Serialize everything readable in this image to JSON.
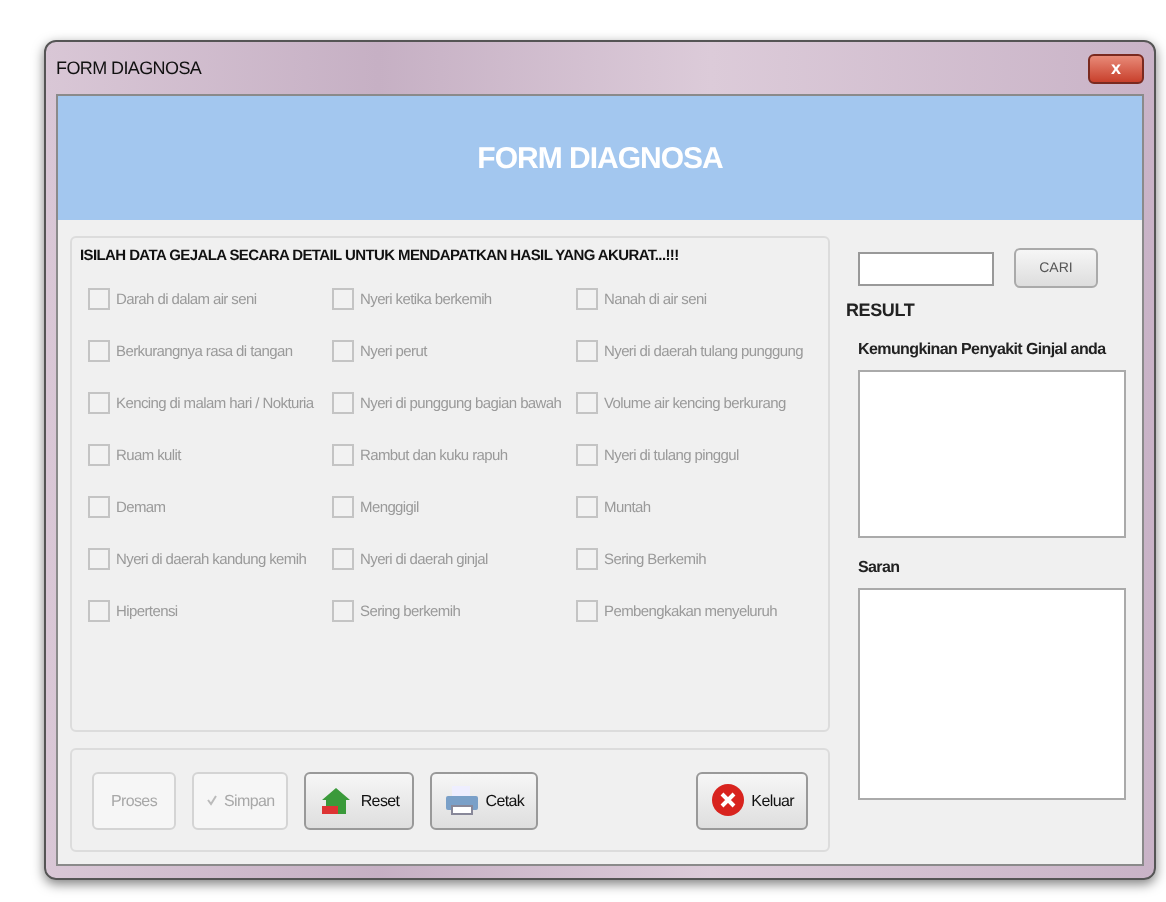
{
  "window": {
    "title": "FORM DIAGNOSA",
    "close": "x"
  },
  "header": {
    "title": "FORM DIAGNOSA"
  },
  "instruction": "ISILAH DATA  GEJALA SECARA DETAIL UNTUK MENDAPATKAN HASIL YANG AKURAT...!!!",
  "symptoms": [
    {
      "label": "Darah di dalam air seni",
      "checked": false,
      "disabled": true
    },
    {
      "label": "Nyeri ketika berkemih",
      "checked": false,
      "disabled": true
    },
    {
      "label": "Nanah di air seni",
      "checked": false,
      "disabled": true
    },
    {
      "label": "Berkurangnya rasa di tangan",
      "checked": false,
      "disabled": true
    },
    {
      "label": "Nyeri perut",
      "checked": false,
      "disabled": true
    },
    {
      "label": "Nyeri di daerah tulang punggung",
      "checked": false,
      "disabled": true
    },
    {
      "label": "Kencing di malam hari / Nokturia",
      "checked": false,
      "disabled": true
    },
    {
      "label": "Nyeri di punggung bagian bawah",
      "checked": false,
      "disabled": true
    },
    {
      "label": "Volume air kencing berkurang",
      "checked": false,
      "disabled": true
    },
    {
      "label": "Ruam kulit",
      "checked": false,
      "disabled": true
    },
    {
      "label": "Rambut dan kuku rapuh",
      "checked": false,
      "disabled": true
    },
    {
      "label": "Nyeri di tulang pinggul",
      "checked": false,
      "disabled": true
    },
    {
      "label": "Demam",
      "checked": false,
      "disabled": true
    },
    {
      "label": "Menggigil",
      "checked": false,
      "disabled": true
    },
    {
      "label": "Muntah",
      "checked": false,
      "disabled": true
    },
    {
      "label": "Nyeri di daerah kandung kemih",
      "checked": false,
      "disabled": true
    },
    {
      "label": "Nyeri di daerah ginjal",
      "checked": false,
      "disabled": true
    },
    {
      "label": "Sering Berkemih",
      "checked": false,
      "disabled": true
    },
    {
      "label": "Hipertensi",
      "checked": false,
      "disabled": true
    },
    {
      "label": "Sering berkemih",
      "checked": false,
      "disabled": true
    },
    {
      "label": "Pembengkakan menyeluruh",
      "checked": false,
      "disabled": true
    }
  ],
  "buttons": [
    {
      "label": "Proses",
      "kind": "none",
      "disabled": true
    },
    {
      "label": "Simpan",
      "kind": "save",
      "disabled": true
    },
    {
      "label": "Reset",
      "kind": "reset",
      "disabled": false
    },
    {
      "label": "Cetak",
      "kind": "print",
      "disabled": false
    },
    {
      "label": "Keluar",
      "kind": "exit",
      "disabled": false
    }
  ],
  "search": {
    "button": "CARI"
  },
  "result": {
    "title": "RESULT",
    "disease_label": "Kemungkinan Penyakit Ginjal anda",
    "advice_label": "Saran"
  }
}
